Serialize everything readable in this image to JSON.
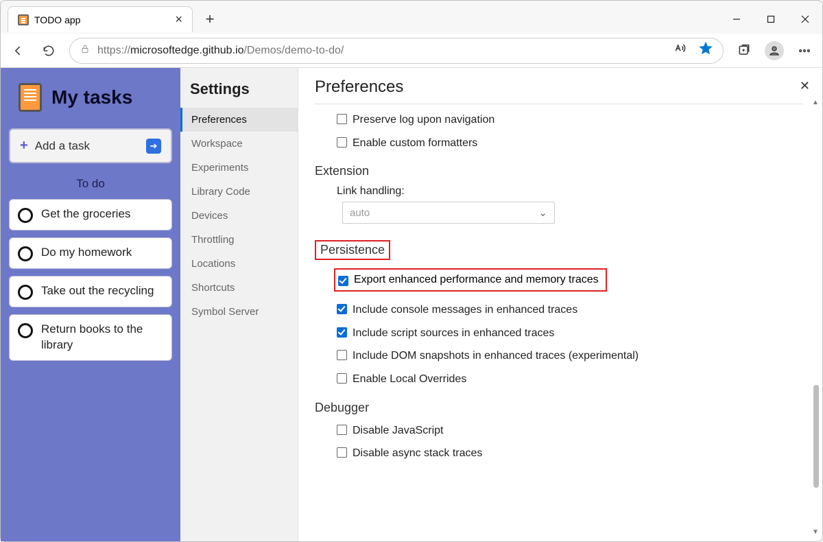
{
  "tab": {
    "title": "TODO app"
  },
  "url": {
    "prefix": "https://",
    "host": "microsoftedge.github.io",
    "path": "/Demos/demo-to-do/"
  },
  "app": {
    "title": "My tasks",
    "add_label": "Add a task",
    "section": "To do",
    "tasks": [
      "Get the groceries",
      "Do my homework",
      "Take out the recycling",
      "Return books to the library"
    ]
  },
  "settings": {
    "heading": "Settings",
    "items": [
      "Preferences",
      "Workspace",
      "Experiments",
      "Library Code",
      "Devices",
      "Throttling",
      "Locations",
      "Shortcuts",
      "Symbol Server"
    ],
    "active_index": 0
  },
  "prefs": {
    "heading": "Preferences",
    "top_options": [
      {
        "label": "Preserve log upon navigation",
        "checked": false
      },
      {
        "label": "Enable custom formatters",
        "checked": false
      }
    ],
    "extension": {
      "heading": "Extension",
      "link_label": "Link handling:",
      "link_value": "auto"
    },
    "persistence": {
      "heading": "Persistence",
      "highlight_label": "Export enhanced performance and memory traces",
      "highlight_checked": true,
      "rest": [
        {
          "label": "Include console messages in enhanced traces",
          "checked": true
        },
        {
          "label": "Include script sources in enhanced traces",
          "checked": true
        },
        {
          "label": "Include DOM snapshots in enhanced traces (experimental)",
          "checked": false
        },
        {
          "label": "Enable Local Overrides",
          "checked": false
        }
      ]
    },
    "debugger": {
      "heading": "Debugger",
      "options": [
        {
          "label": "Disable JavaScript",
          "checked": false
        },
        {
          "label": "Disable async stack traces",
          "checked": false
        }
      ]
    }
  }
}
